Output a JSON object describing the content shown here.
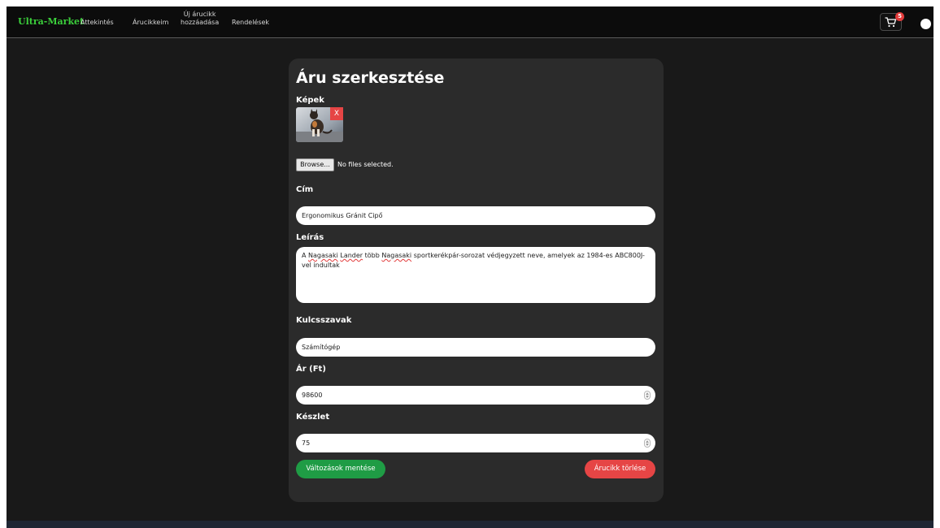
{
  "navbar": {
    "brand": "Ultra-Market",
    "links": [
      "Áttekintés",
      "Árucikkeim"
    ],
    "new_item_line1": "Új árucikk",
    "new_item_line2": "hozzáadása",
    "orders": "Rendelések",
    "cart_count": "5"
  },
  "form": {
    "title": "Áru szerkesztése",
    "images_label": "Képek",
    "image_remove": "X",
    "browse_label": "Browse...",
    "file_status": "No files selected.",
    "title_label": "Cím",
    "title_value": "Ergonomikus Gránit Cipő",
    "description_label": "Leírás",
    "description_parts": [
      "A ",
      "Nagasaki",
      " ",
      "Lander",
      " több ",
      "Nagasaki",
      " sportkerékpár-sorozat védjegyzett neve, amelyek az 1984-es ABC800J-vel indultak"
    ],
    "keywords_label": "Kulcsszavak",
    "keywords_value": "Számítógép",
    "price_label": "Ár (Ft)",
    "price_value": "98600",
    "stock_label": "Készlet",
    "stock_value": "75",
    "save_label": "Változások mentése",
    "delete_label": "Árucikk törlése"
  },
  "colors": {
    "brand": "#3bcf3b",
    "save": "#1f9c45",
    "delete": "#e64545",
    "badge": "#e23b3b"
  },
  "icons": [
    "cart-icon",
    "avatar",
    "spinner-icon"
  ]
}
